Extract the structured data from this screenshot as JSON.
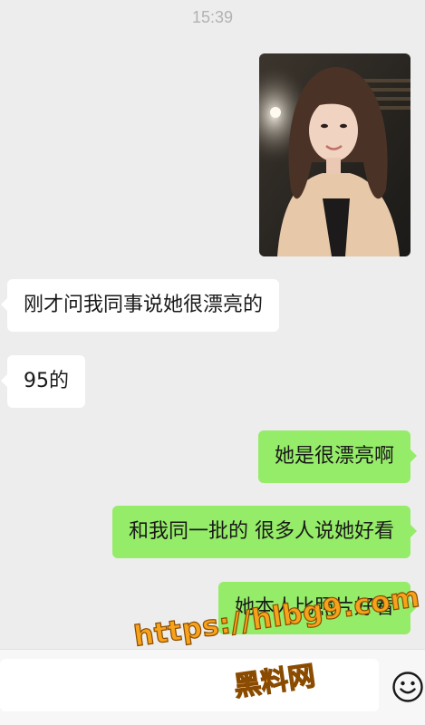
{
  "chat": {
    "timestamp": "15:39",
    "messages": [
      {
        "side": "right",
        "type": "image"
      },
      {
        "side": "left",
        "type": "text",
        "text": "刚才问我同事说她很漂亮的"
      },
      {
        "side": "left",
        "type": "text",
        "text": "95的"
      },
      {
        "side": "right",
        "type": "text",
        "text": "她是很漂亮啊"
      },
      {
        "side": "right",
        "type": "text",
        "text": "和我同一批的 很多人说她好看"
      },
      {
        "side": "right",
        "type": "text",
        "text": "她本人比照片好看"
      }
    ]
  },
  "input_bar": {
    "text_value": "",
    "emoji_icon": "smiley-face-icon"
  },
  "watermark": {
    "url": "https://hlbg9.com",
    "name": "黑料网"
  },
  "colors": {
    "background": "#ededed",
    "sent_bubble": "#95ec69",
    "received_bubble": "#ffffff",
    "watermark": "#f7a21b"
  }
}
